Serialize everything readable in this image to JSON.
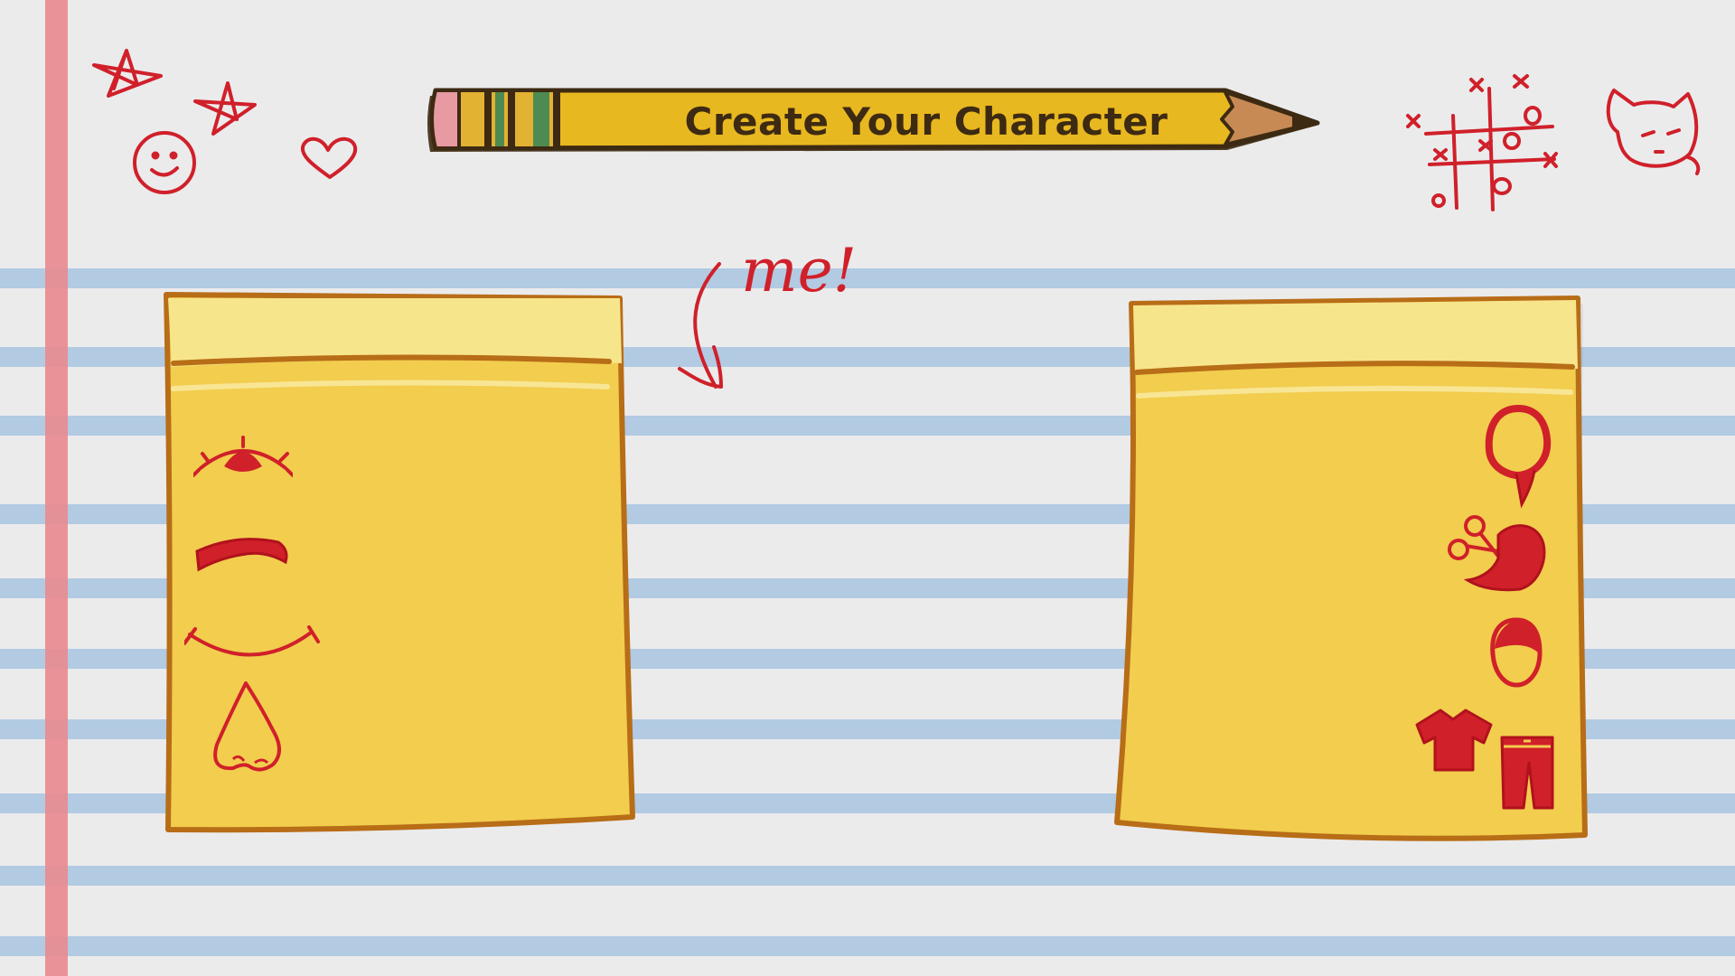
{
  "screen": {
    "title": "Create Your Character",
    "doodle_note": "me!"
  },
  "colors": {
    "paper": "#ebebec",
    "rule_line": "#a8c4e0",
    "margin_line": "#e98a8f",
    "ink_red": "#d0202a",
    "sticky_note": "#f2cd4e",
    "sticky_outline": "#b86d17",
    "pencil_body": "#e8b820"
  },
  "left_panel": {
    "name": "face-features",
    "icons": [
      "eye-icon",
      "eyebrow-icon",
      "mouth-icon",
      "nose-icon"
    ]
  },
  "right_panel": {
    "name": "style-features",
    "icons": [
      "head-shape-icon",
      "hairstyle-icon",
      "hair-color-icon",
      "shirt-icon",
      "pants-icon"
    ]
  },
  "decorations": [
    "star-doodle-icon",
    "smiley-doodle-icon",
    "heart-doodle-icon",
    "tic-tac-toe-doodle-icon",
    "cat-doodle-icon",
    "arrow-doodle-icon"
  ]
}
